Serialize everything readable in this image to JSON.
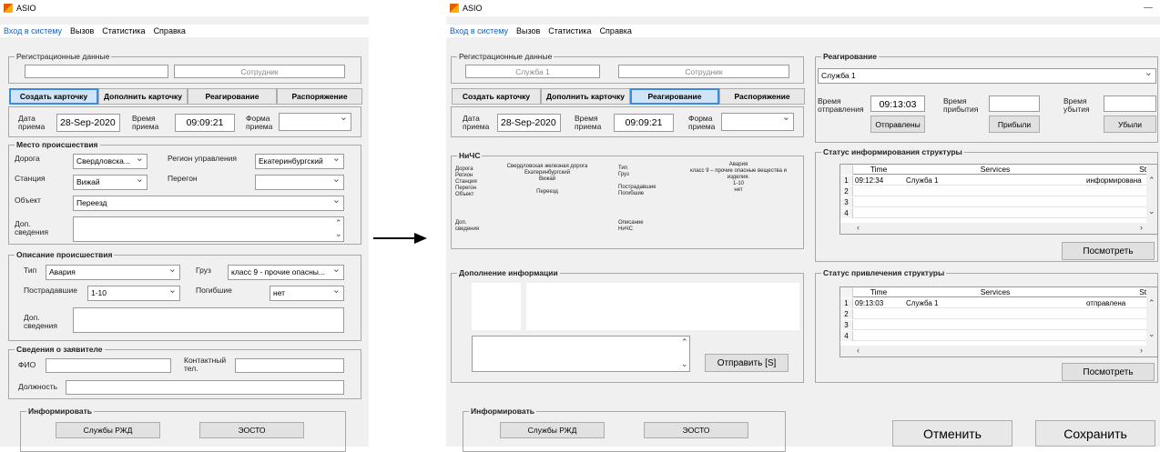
{
  "app_title": "ASIO",
  "menu": [
    "Вход в систему",
    "Вызов",
    "Статистика",
    "Справка"
  ],
  "window_minimize": "—",
  "left": {
    "reg_group": "Регистрационные данные",
    "reg_field1": "",
    "reg_field2_placeholder": "Сотрудник",
    "tabs": [
      "Создать карточку",
      "Дополнить карточку",
      "Реагирование",
      "Распоряжение"
    ],
    "date_label": "Дата\nприема",
    "date_value": "28-Sep-2020",
    "time_label": "Время\nприема",
    "time_value": "09:09:21",
    "form_label": "Форма\nприема",
    "form_value": "",
    "place_group": "Место происшествия",
    "road_label": "Дорога",
    "road_value": "Свердловска...",
    "region_label": "Регион управления",
    "region_value": "Екатеринбургский",
    "station_label": "Станция",
    "station_value": "Вижай",
    "span_label": "Перегон",
    "span_value": "",
    "object_label": "Объект",
    "object_value": "Переезд",
    "extra_label": "Доп.\nсведения",
    "extra_value": "",
    "desc_group": "Описание происшествия",
    "type_label": "Тип",
    "type_value": "Авария",
    "cargo_label": "Груз",
    "cargo_value": "класс 9 - прочие опасны...",
    "victims_label": "Пострадавшие",
    "victims_value": "1-10",
    "dead_label": "Погибшие",
    "dead_value": "нет",
    "desc_extra_label": "Доп.\nсведения",
    "desc_extra_value": "",
    "applicant_group": "Сведения о заявителе",
    "fio_label": "ФИО",
    "fio_value": "",
    "contact_label": "Контактный\nтел.",
    "contact_value": "",
    "position_label": "Должность",
    "position_value": "",
    "inform_group": "Информировать",
    "inform_btn1": "Службы РЖД",
    "inform_btn2": "ЭОСТО"
  },
  "right": {
    "reg_group": "Регистрационные данные",
    "reg_field1": "Служба 1",
    "reg_field2_placeholder": "Сотрудник",
    "tabs": [
      "Создать карточку",
      "Дополнить карточку",
      "Реагирование",
      "Распоряжение"
    ],
    "date_label": "Дата\nприема",
    "date_value": "28-Sep-2020",
    "time_label": "Время\nприема",
    "time_value": "09:09:21",
    "form_label": "Форма\nприема",
    "nchs": {
      "group": "НиЧС",
      "left_labels": "Дорога\nРегион\nСтанция\nПерегон\nОбъект",
      "left_values": "Свердловская железная дорога\nЕкатеринбургский\nВижай\n\nПереезд",
      "mid_labels": "Тип\nГруз\n\nПострадавшие\nПогибшие",
      "right_values": "Авария\nкласс 9 – прочие опасные вещества и\nизделия.\n1-10\nнет",
      "extra_label": "Доп.\nсведения",
      "desc_label": "Описание\nНиЧС"
    },
    "supplement_group": "Дополнение информации",
    "send_btn": "Отправить [S]",
    "inform_group": "Информировать",
    "inform_btn1": "Службы РЖД",
    "inform_btn2": "ЭОСТО",
    "response_group": "Реагирование",
    "service_select": "Служба 1",
    "dispatch_label": "Время\nотправления",
    "dispatch_time": "09:13:03",
    "arrival_label": "Время\nприбытия",
    "arrival_time": "",
    "departure_label": "Время\nубытия",
    "departure_time": "",
    "sent_btn": "Отправлены",
    "arrived_btn": "Прибыли",
    "left_btn": "Убыли",
    "info_status_group": "Статус информирования структуры",
    "info_table": {
      "headers": [
        "Time",
        "Services",
        "Statu"
      ],
      "rows": [
        [
          "1",
          "09:12:34",
          "Служба 1",
          "информирована"
        ],
        [
          "2",
          "",
          "",
          ""
        ],
        [
          "3",
          "",
          "",
          ""
        ],
        [
          "4",
          "",
          "",
          ""
        ]
      ]
    },
    "view_btn1": "Посмотреть",
    "attract_status_group": "Статус привлечения структуры",
    "attract_table": {
      "headers": [
        "Time",
        "Services",
        "Statu"
      ],
      "rows": [
        [
          "1",
          "09:13:03",
          "Служба 1",
          "отправлена"
        ],
        [
          "2",
          "",
          "",
          ""
        ],
        [
          "3",
          "",
          "",
          ""
        ],
        [
          "4",
          "",
          "",
          ""
        ]
      ]
    },
    "view_btn2": "Посмотреть",
    "cancel_btn": "Отменить",
    "save_btn": "Сохранить"
  }
}
